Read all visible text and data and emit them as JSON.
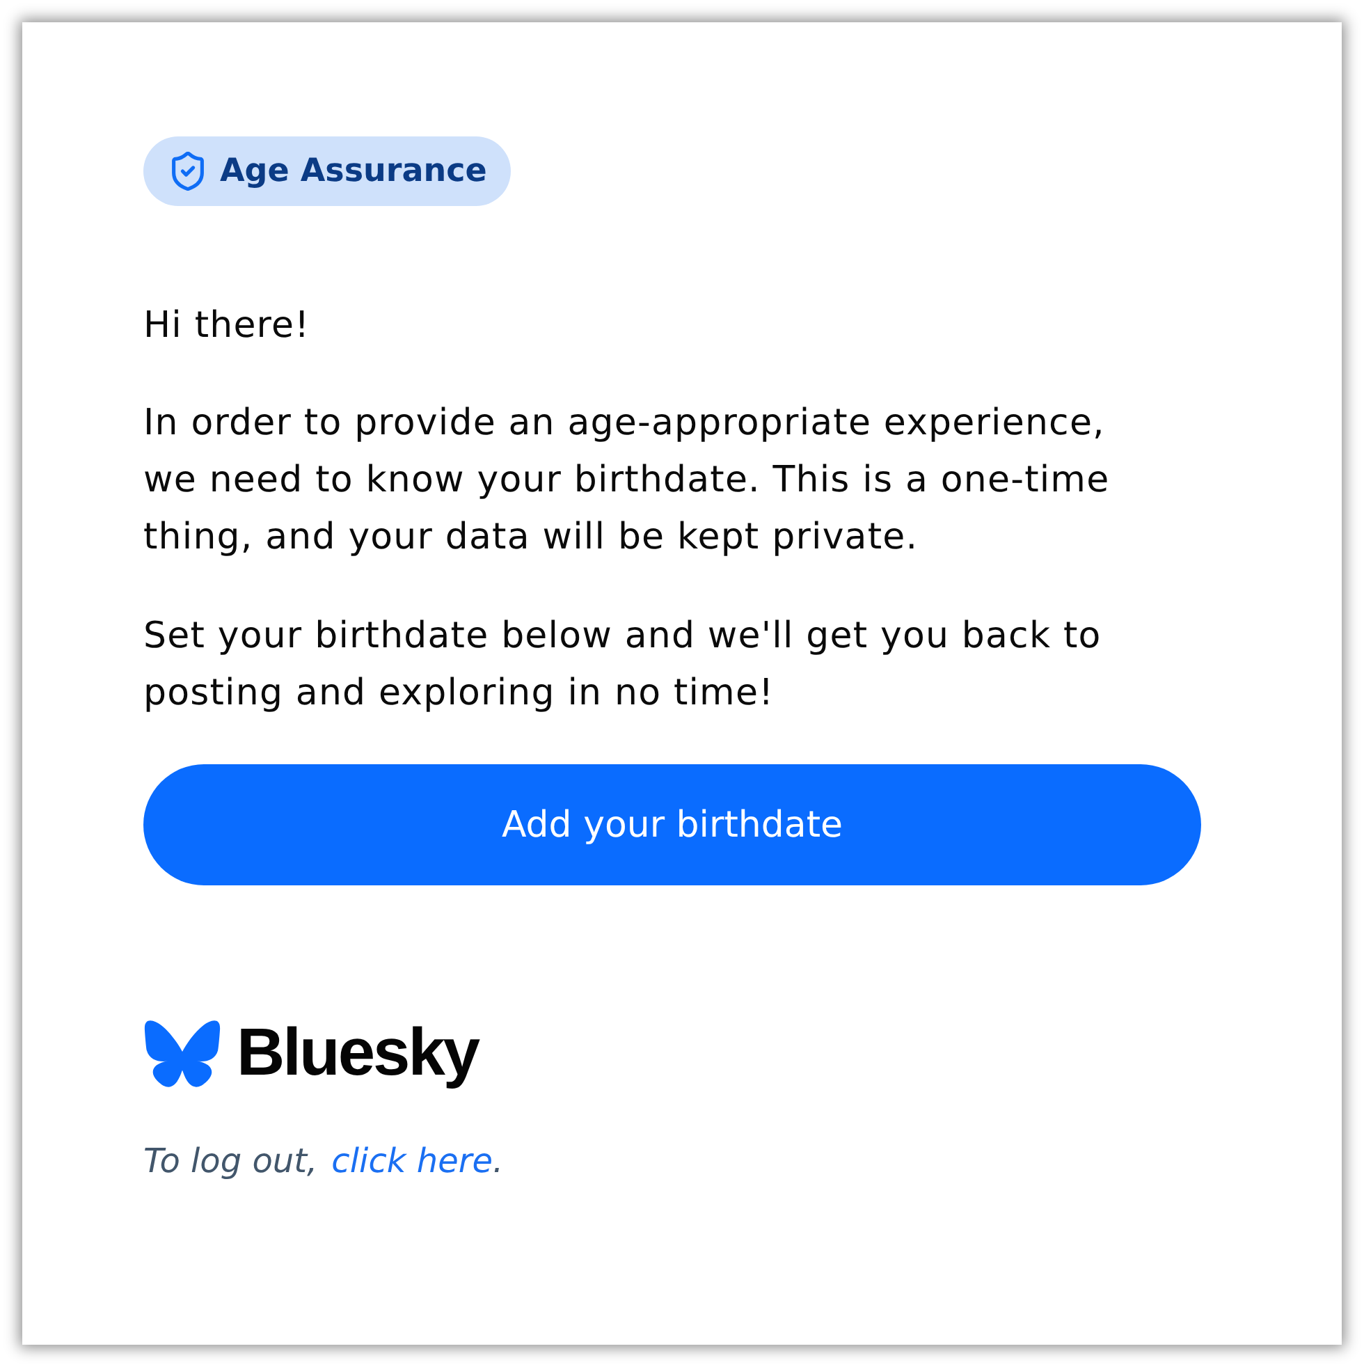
{
  "badge": {
    "label": "Age Assurance"
  },
  "greeting": "Hi there!",
  "paragraphs": [
    "In order to provide an age-appropriate experience, we need to know your birthdate. This is a one-time thing, and your data will be kept private.",
    "Set your birthdate below and we'll get you back to posting and exploring in no time!"
  ],
  "button": {
    "label": "Add your birthdate"
  },
  "logo": {
    "wordmark": "Bluesky"
  },
  "footer": {
    "text": "To log out,",
    "link": "click here",
    "after": "."
  }
}
